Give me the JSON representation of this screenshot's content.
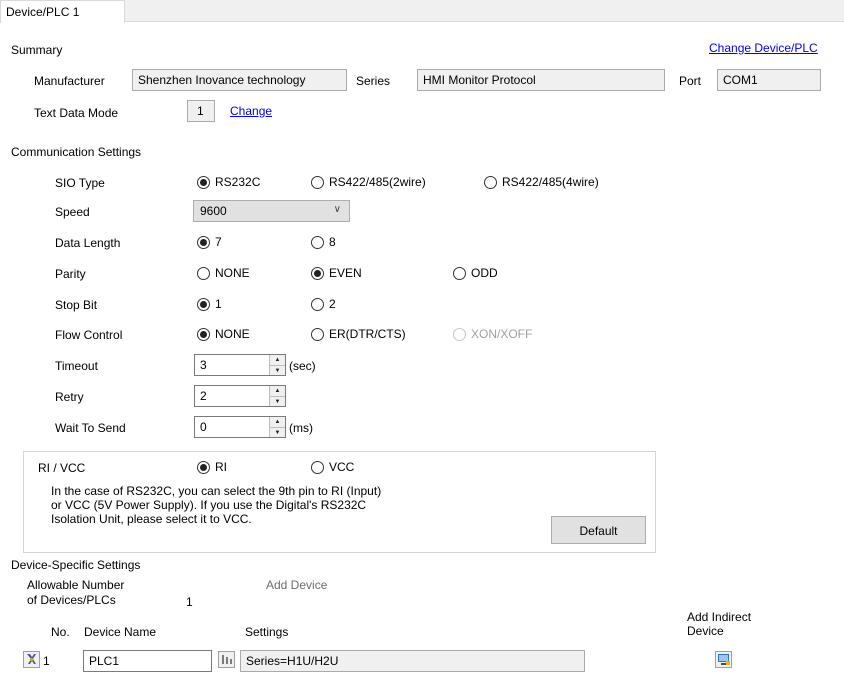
{
  "tab": {
    "label": "Device/PLC 1"
  },
  "summary": {
    "heading": "Summary",
    "change_device_link": "Change Device/PLC",
    "manufacturer_label": "Manufacturer",
    "manufacturer_value": "Shenzhen Inovance technology",
    "series_label": "Series",
    "series_value": "HMI Monitor Protocol",
    "port_label": "Port",
    "port_value": "COM1",
    "text_mode_label": "Text Data Mode",
    "text_mode_value": "1",
    "text_mode_change": "Change"
  },
  "comm": {
    "heading": "Communication Settings",
    "sio_label": "SIO Type",
    "sio_options": [
      "RS232C",
      "RS422/485(2wire)",
      "RS422/485(4wire)"
    ],
    "speed_label": "Speed",
    "speed_value": "9600",
    "data_length_label": "Data Length",
    "data_length_options": [
      "7",
      "8"
    ],
    "parity_label": "Parity",
    "parity_options": [
      "NONE",
      "EVEN",
      "ODD"
    ],
    "stop_bit_label": "Stop Bit",
    "stop_bit_options": [
      "1",
      "2"
    ],
    "flow_label": "Flow Control",
    "flow_options": [
      "NONE",
      "ER(DTR/CTS)",
      "XON/XOFF"
    ],
    "timeout_label": "Timeout",
    "timeout_value": "3",
    "timeout_unit": "(sec)",
    "retry_label": "Retry",
    "retry_value": "2",
    "wait_label": "Wait To Send",
    "wait_value": "0",
    "wait_unit": "(ms)"
  },
  "rivcc": {
    "label": "RI / VCC",
    "options": [
      "RI",
      "VCC"
    ],
    "note_line1": "In the case of RS232C, you can select the 9th pin to RI (Input)",
    "note_line2": "or VCC (5V Power Supply). If you use the Digital's RS232C",
    "note_line3": "Isolation Unit, please select it to VCC.",
    "default_button": "Default"
  },
  "device_specific": {
    "heading": "Device-Specific Settings",
    "allowable_line1": "Allowable Number",
    "allowable_line2": "of Devices/PLCs",
    "allowable_value": "1",
    "add_device": "Add Device",
    "add_indirect_line1": "Add Indirect",
    "add_indirect_line2": "Device",
    "col_no": "No.",
    "col_device_name": "Device Name",
    "col_settings": "Settings",
    "rows": [
      {
        "no": "1",
        "name": "PLC1",
        "settings": "Series=H1U/H2U"
      }
    ]
  }
}
